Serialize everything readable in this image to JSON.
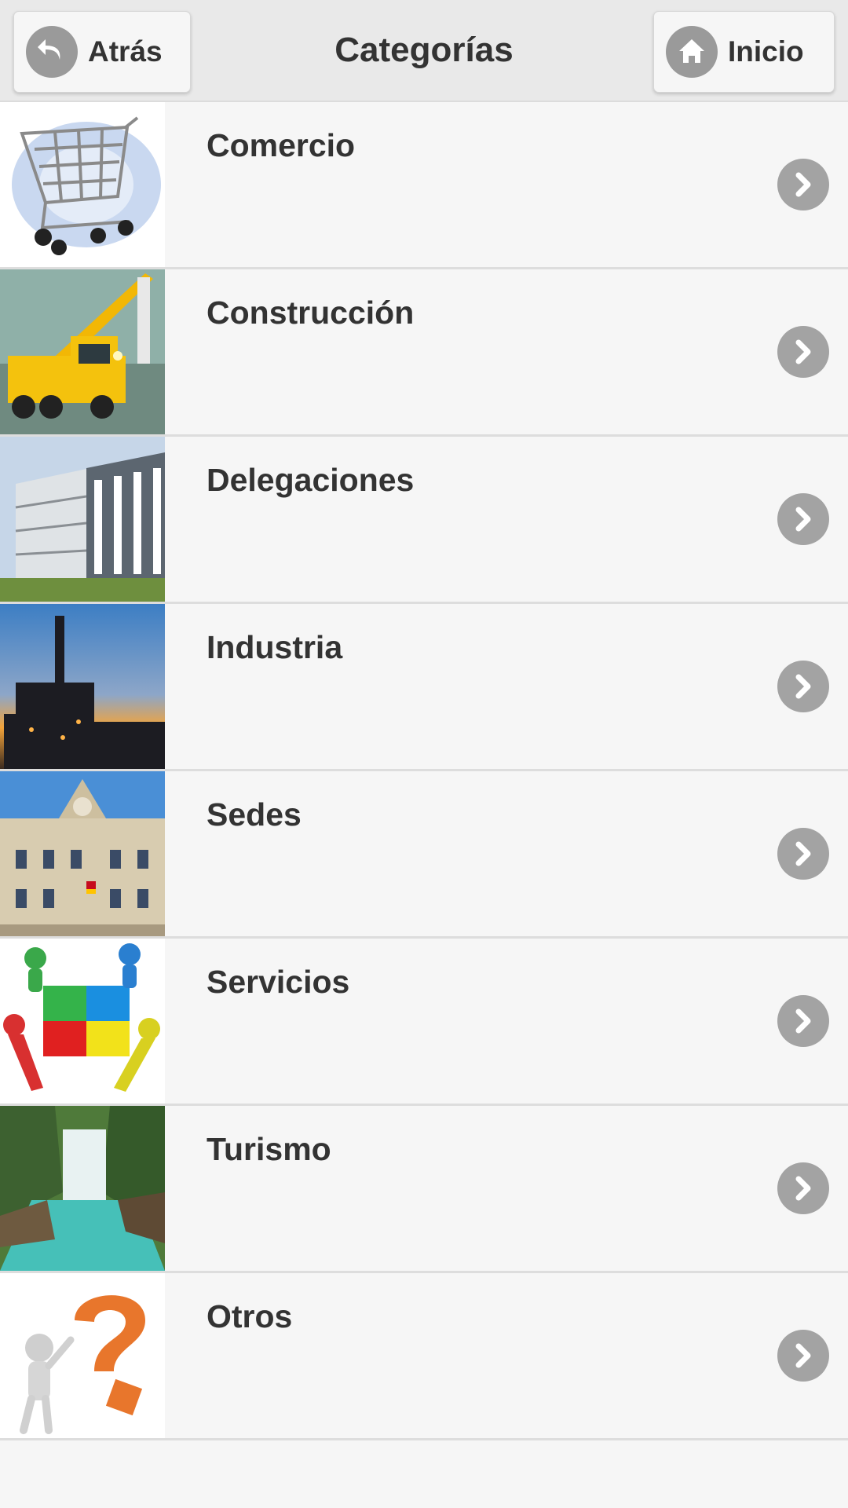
{
  "header": {
    "title": "Categorías",
    "back_label": "Atrás",
    "home_label": "Inicio",
    "back_icon": "undo-arrow-icon",
    "home_icon": "home-icon"
  },
  "categories": [
    {
      "label": "Comercio",
      "image": "shopping-cart-image"
    },
    {
      "label": "Construcción",
      "image": "crane-truck-image"
    },
    {
      "label": "Delegaciones",
      "image": "office-building-image"
    },
    {
      "label": "Industria",
      "image": "industrial-plant-sunset-image"
    },
    {
      "label": "Sedes",
      "image": "historic-palace-image"
    },
    {
      "label": "Servicios",
      "image": "people-puzzle-image"
    },
    {
      "label": "Turismo",
      "image": "waterfall-river-image"
    },
    {
      "label": "Otros",
      "image": "question-mark-figure-image"
    }
  ],
  "colors": {
    "header_bg": "#e9e9e9",
    "list_bg": "#f6f6f6",
    "icon_gray": "#a3a3a3",
    "text": "#333333"
  }
}
